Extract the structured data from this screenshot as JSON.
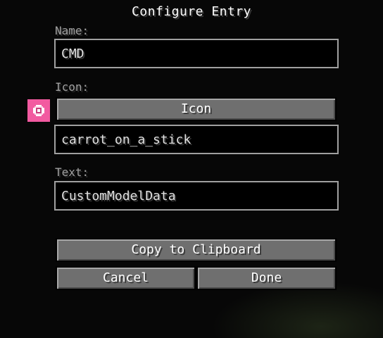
{
  "dialog": {
    "title": "Configure Entry"
  },
  "name_section": {
    "label": "Name:",
    "value": "CMD"
  },
  "icon_section": {
    "label": "Icon:",
    "button_label": "Icon",
    "preview_icon": "pink-item-icon",
    "value": "carrot_on_a_stick"
  },
  "text_section": {
    "label": "Text:",
    "value": "CustomModelData"
  },
  "buttons": {
    "copy": "Copy to Clipboard",
    "cancel": "Cancel",
    "done": "Done"
  },
  "colors": {
    "background": "#070707",
    "label": "#a0a0a0",
    "field_border": "#a0a0a0",
    "button_face": "#6f6f6f",
    "icon_bg": "#f25aa0"
  }
}
